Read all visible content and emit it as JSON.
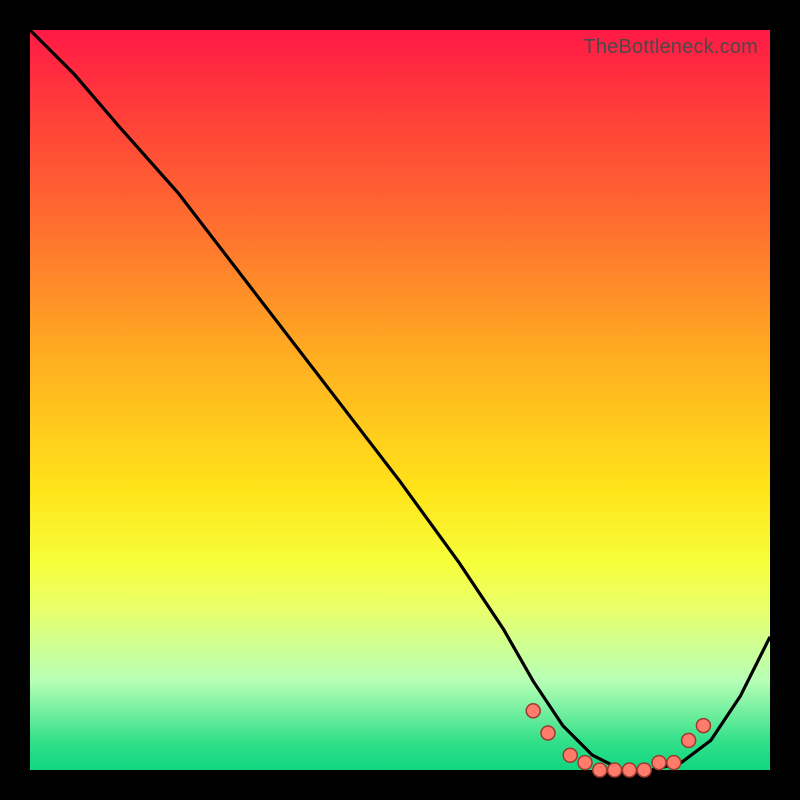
{
  "watermark": "TheBottleneck.com",
  "colors": {
    "background": "#000000",
    "curve": "#000000",
    "dot_fill": "#ff7b6b",
    "dot_stroke": "#9c3a2e"
  },
  "chart_data": {
    "type": "line",
    "title": "",
    "xlabel": "",
    "ylabel": "",
    "xlim": [
      0,
      100
    ],
    "ylim": [
      0,
      100
    ],
    "grid": false,
    "series": [
      {
        "name": "bottleneck-curve",
        "x": [
          0,
          6,
          12,
          20,
          30,
          40,
          50,
          58,
          64,
          68,
          72,
          76,
          80,
          84,
          88,
          92,
          96,
          100
        ],
        "y": [
          100,
          94,
          87,
          78,
          65,
          52,
          39,
          28,
          19,
          12,
          6,
          2,
          0,
          0,
          1,
          4,
          10,
          18
        ]
      }
    ],
    "markers": {
      "name": "highlight-dots",
      "x": [
        68,
        70,
        73,
        75,
        77,
        79,
        81,
        83,
        85,
        87,
        89,
        91
      ],
      "y": [
        8,
        5,
        2,
        1,
        0,
        0,
        0,
        0,
        1,
        1,
        4,
        6
      ]
    }
  }
}
